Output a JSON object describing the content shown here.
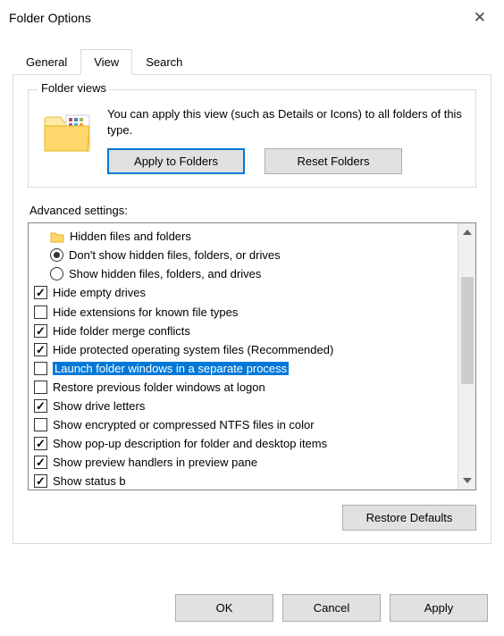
{
  "window": {
    "title": "Folder Options"
  },
  "tabs": {
    "general": "General",
    "view": "View",
    "search": "Search"
  },
  "folderviews": {
    "legend": "Folder views",
    "text": "You can apply this view (such as Details or Icons) to all folders of this type.",
    "apply": "Apply to Folders",
    "reset": "Reset Folders"
  },
  "advanced": {
    "label": "Advanced settings:",
    "heading": "Hidden files and folders",
    "items": [
      {
        "kind": "radio",
        "checked": true,
        "label": "Don't show hidden files, folders, or drives"
      },
      {
        "kind": "radio",
        "checked": false,
        "label": "Show hidden files, folders, and drives"
      },
      {
        "kind": "checkbox",
        "checked": true,
        "label": "Hide empty drives"
      },
      {
        "kind": "checkbox",
        "checked": false,
        "label": "Hide extensions for known file types"
      },
      {
        "kind": "checkbox",
        "checked": true,
        "label": "Hide folder merge conflicts"
      },
      {
        "kind": "checkbox",
        "checked": true,
        "label": "Hide protected operating system files (Recommended)"
      },
      {
        "kind": "checkbox",
        "checked": false,
        "label": "Launch folder windows in a separate process",
        "selected": true
      },
      {
        "kind": "checkbox",
        "checked": false,
        "label": "Restore previous folder windows at logon"
      },
      {
        "kind": "checkbox",
        "checked": true,
        "label": "Show drive letters"
      },
      {
        "kind": "checkbox",
        "checked": false,
        "label": "Show encrypted or compressed NTFS files in color"
      },
      {
        "kind": "checkbox",
        "checked": true,
        "label": "Show pop-up description for folder and desktop items"
      },
      {
        "kind": "checkbox",
        "checked": true,
        "label": "Show preview handlers in preview pane"
      },
      {
        "kind": "checkbox",
        "checked": true,
        "label": "Show status bar",
        "clipped": true
      }
    ]
  },
  "restore": "Restore Defaults",
  "buttons": {
    "ok": "OK",
    "cancel": "Cancel",
    "apply": "Apply"
  }
}
